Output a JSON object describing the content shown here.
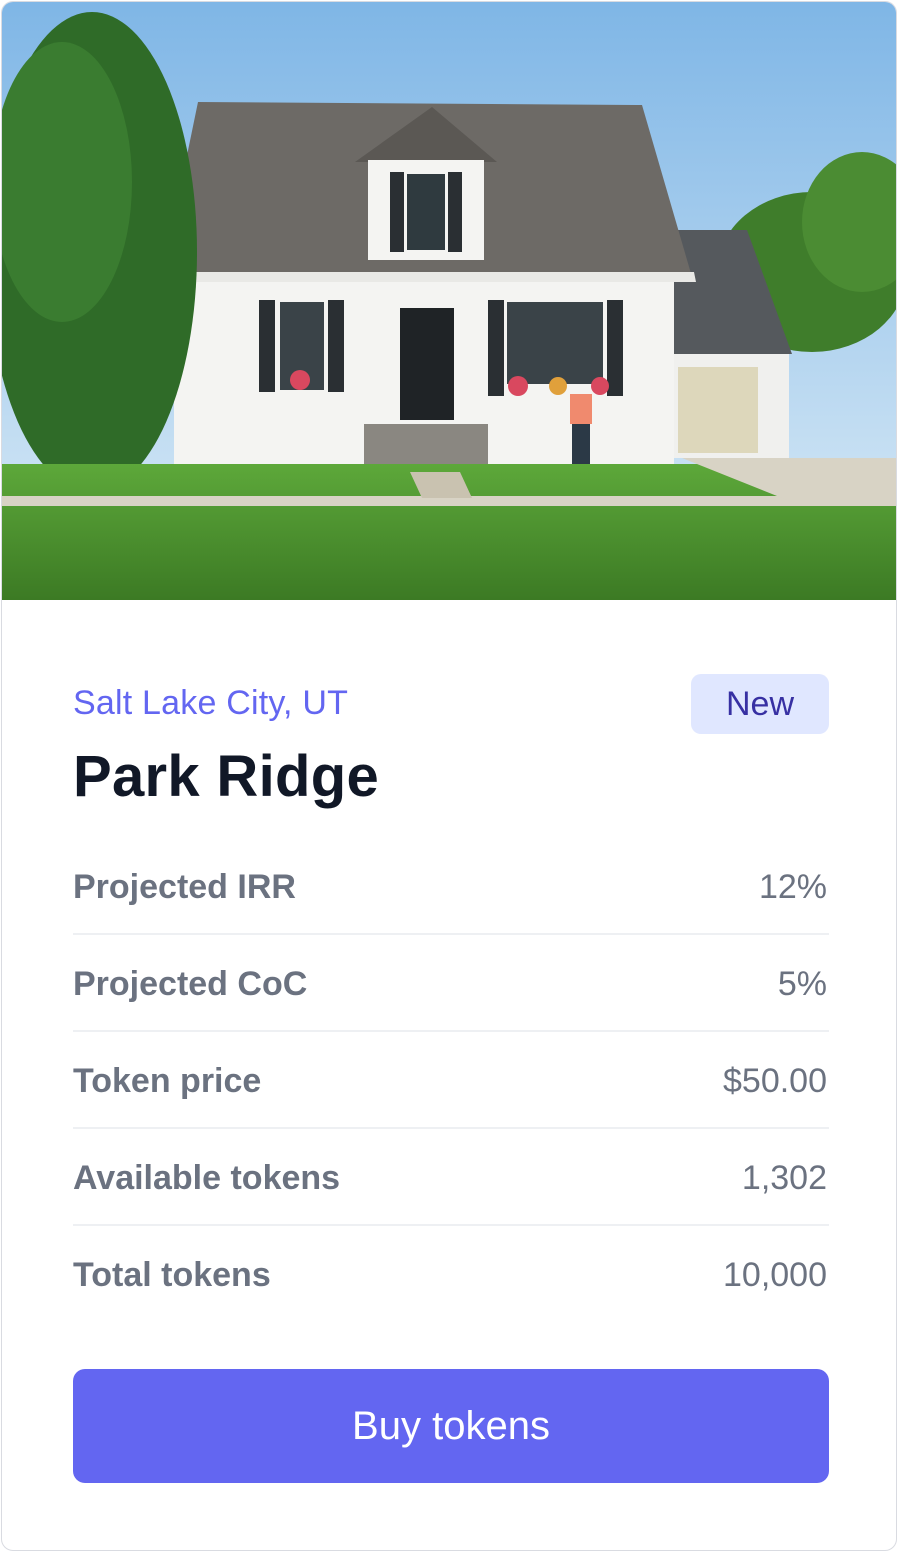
{
  "property": {
    "image_alt": "House photo",
    "location": "Salt Lake City, UT",
    "badge": "New",
    "name": "Park Ridge"
  },
  "stats": [
    {
      "label": "Projected IRR",
      "value": "12%"
    },
    {
      "label": "Projected CoC",
      "value": "5%"
    },
    {
      "label": "Token price",
      "value": "$50.00"
    },
    {
      "label": "Available tokens",
      "value": "1,302"
    },
    {
      "label": "Total tokens",
      "value": "10,000"
    }
  ],
  "actions": {
    "buy_label": "Buy tokens"
  },
  "colors": {
    "accent": "#6366f1",
    "badge_bg": "#e0e7ff",
    "badge_text": "#3730a3",
    "title": "#111827",
    "muted": "#6b7280"
  }
}
